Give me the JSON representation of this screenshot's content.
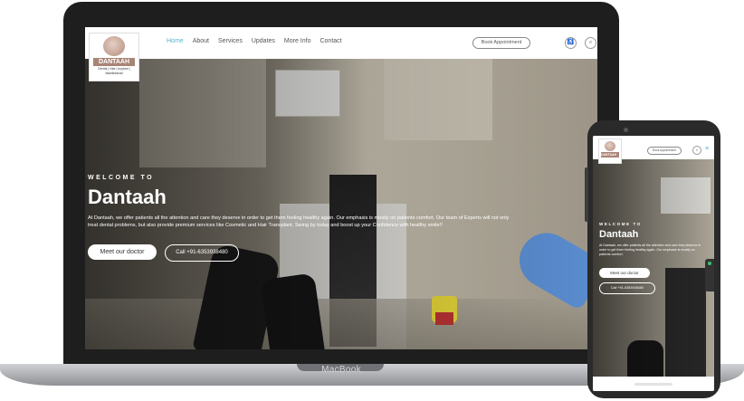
{
  "device_labels": {
    "laptop": "MacBook"
  },
  "site": {
    "logo": {
      "name": "DANTAAH",
      "tagline": "Dental | Hair | Implant | Maxillofacial"
    },
    "nav": {
      "links": [
        "Home",
        "About",
        "Services",
        "Updates",
        "More Info",
        "Contact"
      ],
      "active": "Home",
      "book_label": "Book Appointment"
    },
    "hero": {
      "welcome": "WELCOME TO",
      "title": "Dantaah",
      "text": "At Dantaah, we offer patients all the attention and care they deserve in order to get them feeling healthy again. Our emphasis is mostly on patients comfort. Our team of Experts will not only treat dental problems, but also provide premium services like Cosmetic and Hair Transplant. Swing by today and boost up your Confidence with healthy smile!!",
      "primary_button": "Meet our doctor",
      "call_button": "Call +91-6353938480"
    }
  },
  "mobile": {
    "book_label": "Book Appointment",
    "hero": {
      "welcome": "WELCOME TO",
      "title": "Dantaah",
      "text": "At Dantaah, we offer patients all the attention and care they deserve in order to get them feeling healthy again. Our emphasis is mostly on patients comfort.",
      "primary_button": "Meet our doctor",
      "call_button": "Call +91-6353938480"
    }
  },
  "icons": [
    "accessibility-icon",
    "search-icon",
    "menu-icon",
    "whatsapp-icon"
  ],
  "colors": {
    "accent": "#55b6c8",
    "logo_brown": "#a98476"
  }
}
